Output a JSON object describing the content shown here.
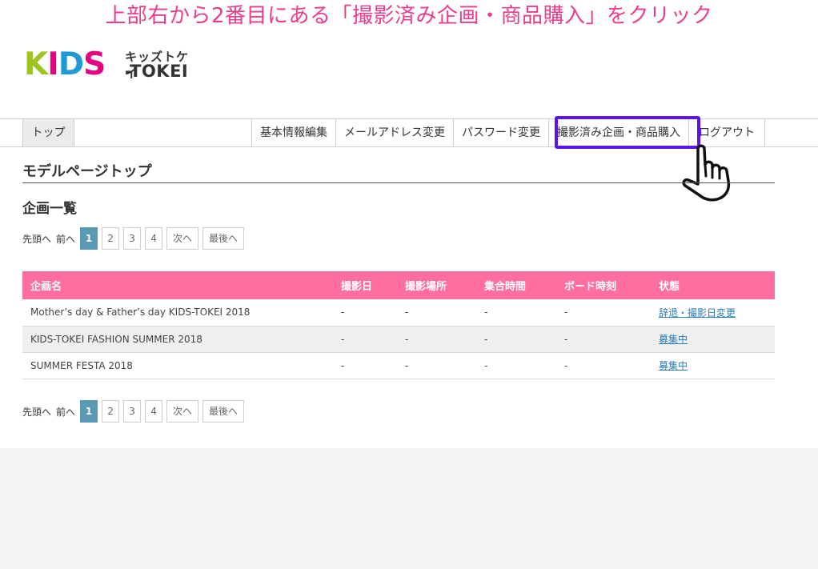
{
  "instruction": "上部右から2番目にある「撮影済み企画・商品購入」をクリック",
  "logo": {
    "kids": [
      "K",
      "I",
      "D",
      "S"
    ],
    "kids_colors": [
      "#9dc41f",
      "#e5007f",
      "#1f9ad6",
      "#e5007f"
    ],
    "jp": "キッズトケイ",
    "en": "-TOKEI"
  },
  "nav": {
    "top": "トップ",
    "items": [
      "基本情報編集",
      "メールアドレス変更",
      "パスワード変更",
      "撮影済み企画・商品購入",
      "ログアウト"
    ]
  },
  "page_title": "モデルページトップ",
  "section_title": "企画一覧",
  "pager": {
    "first": "先頭へ",
    "prev": "前へ",
    "pages": [
      "1",
      "2",
      "3",
      "4"
    ],
    "next": "次へ",
    "last": "最後へ",
    "current": "1"
  },
  "table": {
    "headers": [
      "企画名",
      "撮影日",
      "撮影場所",
      "集合時間",
      "ボード時刻",
      "状態"
    ],
    "rows": [
      {
        "name": "Mother’s day & Father’s day KIDS-TOKEI 2018",
        "date": "-",
        "place": "-",
        "meet": "-",
        "board": "-",
        "status": "辞退・撮影日変更"
      },
      {
        "name": "KIDS-TOKEI FASHION SUMMER 2018",
        "date": "-",
        "place": "-",
        "meet": "-",
        "board": "-",
        "status": "募集中"
      },
      {
        "name": "SUMMER FESTA 2018",
        "date": "-",
        "place": "-",
        "meet": "-",
        "board": "-",
        "status": "募集中"
      }
    ]
  },
  "colors": {
    "accent_pink": "#ff6e9f",
    "highlight": "#5b14f0",
    "instruction": "#ea3c8e",
    "active_page": "#5b98b3"
  }
}
